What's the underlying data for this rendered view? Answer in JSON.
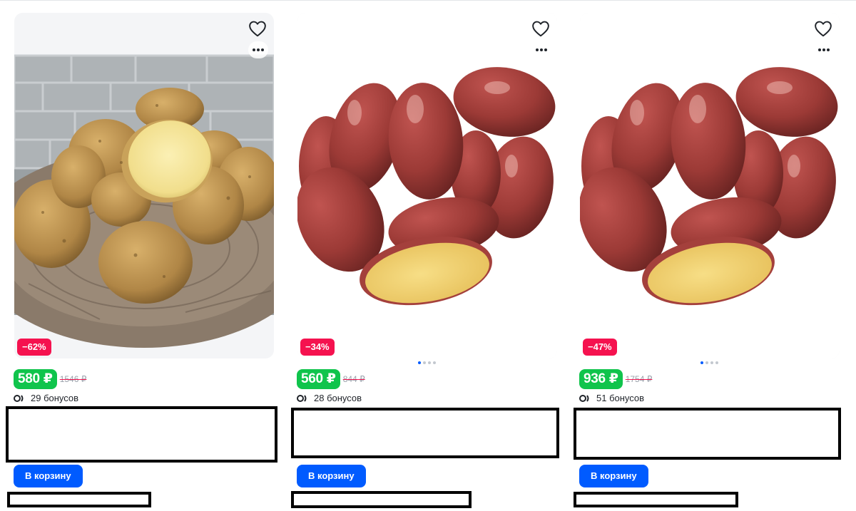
{
  "products": [
    {
      "discount": "−62%",
      "price": "580 ₽",
      "old_price": "1546 ₽",
      "bonus": "29 бонусов",
      "cart_label": "В корзину",
      "image": "yellow-potatoes-photo",
      "has_carousel_dots": false
    },
    {
      "discount": "−34%",
      "price": "560 ₽",
      "old_price": "844 ₽",
      "bonus": "28 бонусов",
      "cart_label": "В корзину",
      "image": "red-potatoes-photo",
      "has_carousel_dots": true
    },
    {
      "discount": "−47%",
      "price": "936 ₽",
      "old_price": "1754 ₽",
      "bonus": "51 бонусов",
      "cart_label": "В корзину",
      "image": "red-potatoes-photo",
      "has_carousel_dots": true
    }
  ],
  "colors": {
    "discount_badge": "#f5124f",
    "price_badge": "#10c44c",
    "cart_button": "#005bff",
    "card_bg": "#f4f5f7"
  },
  "icons": [
    "heart-icon",
    "more-dots-icon",
    "bonus-icon"
  ]
}
